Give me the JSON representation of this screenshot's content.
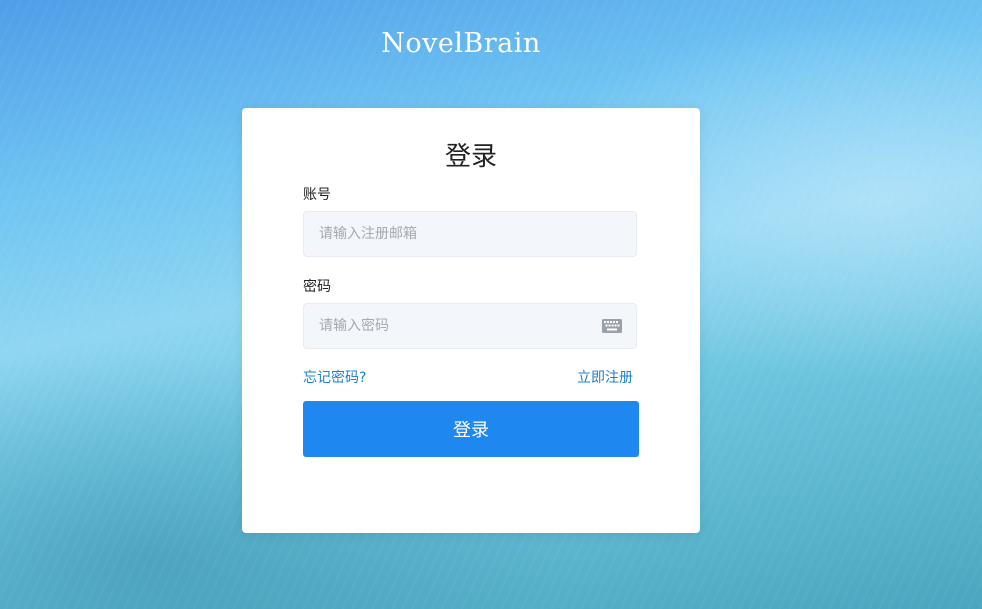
{
  "app": {
    "title": "NovelBrain"
  },
  "login_card": {
    "title": "登录",
    "account": {
      "label": "账号",
      "placeholder": "请输入注册邮箱",
      "value": ""
    },
    "password": {
      "label": "密码",
      "placeholder": "请输入密码",
      "value": "",
      "icon": "keyboard-icon"
    },
    "forgot_password_link": "忘记密码?",
    "register_link": "立即注册",
    "submit_label": "登录"
  },
  "colors": {
    "accent": "#1e88f0",
    "link": "#1e7fd0",
    "input_bg": "#f3f6fb"
  }
}
